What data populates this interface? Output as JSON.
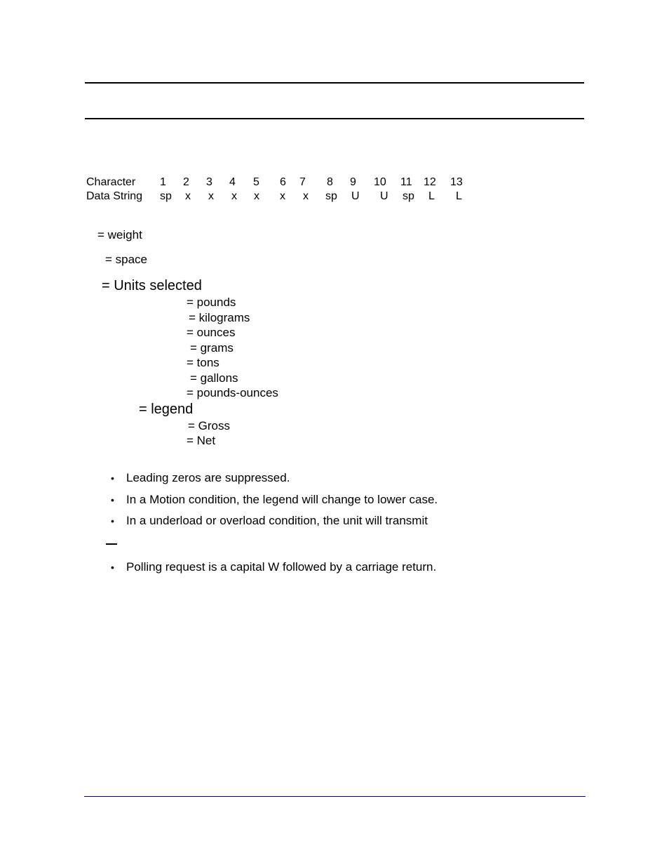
{
  "table": {
    "row_label_character": "Character",
    "row_label_data": "Data String",
    "characters": [
      "1",
      "2",
      "3",
      "4",
      "5",
      "6",
      "7",
      "8",
      "9",
      "10",
      "11",
      "12",
      "13"
    ],
    "data_string": [
      "sp",
      "x",
      "x",
      "x",
      "x",
      "x",
      "x",
      "sp",
      "U",
      "U",
      "sp",
      "L",
      "L"
    ]
  },
  "definitions": {
    "weight": "= weight",
    "space": "= space",
    "units_selected": "= Units selected",
    "units": [
      "= pounds",
      "= kilograms",
      "= ounces",
      "= grams",
      "= tons",
      "= gallons",
      "= pounds-ounces"
    ],
    "legend": "= legend",
    "legends": [
      "= Gross",
      "= Net"
    ]
  },
  "notes": [
    "Leading zeros are suppressed.",
    "In a Motion condition, the legend will change to lower case.",
    "In a underload or overload condition, the unit will transmit",
    "Polling request is a capital W followed by a carriage return."
  ],
  "bullet_glyph": "•",
  "colors": {
    "text": "#000000",
    "footer_rule": "#0a0a50"
  }
}
